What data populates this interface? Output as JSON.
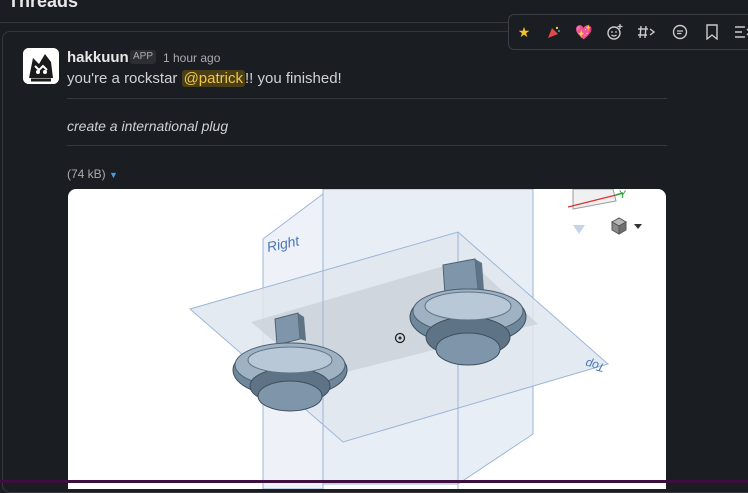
{
  "header": {
    "title": "Threads"
  },
  "toolbar": {
    "icons": [
      "star-icon",
      "party-icon",
      "heart-icon",
      "add-reaction-icon",
      "hashtag-forward-icon",
      "reply-thread-icon",
      "bookmark-icon",
      "more-icon"
    ]
  },
  "message": {
    "author": "hakkuun",
    "badge": "APP",
    "time": "1 hour ago",
    "text_before": "you're a rockstar ",
    "mention": "@patrick",
    "text_after": "!! you finished!",
    "prompt": "create a international plug",
    "file_size": "(74 kB)"
  },
  "viewport": {
    "plane_right": "Right",
    "plane_top": "Top",
    "axis_y": "Y"
  },
  "colors": {
    "background": "#1a1d21",
    "mention_bg": "#4a3f17",
    "mention_text": "#f2c744",
    "plane_stroke": "#8fb0d6"
  }
}
